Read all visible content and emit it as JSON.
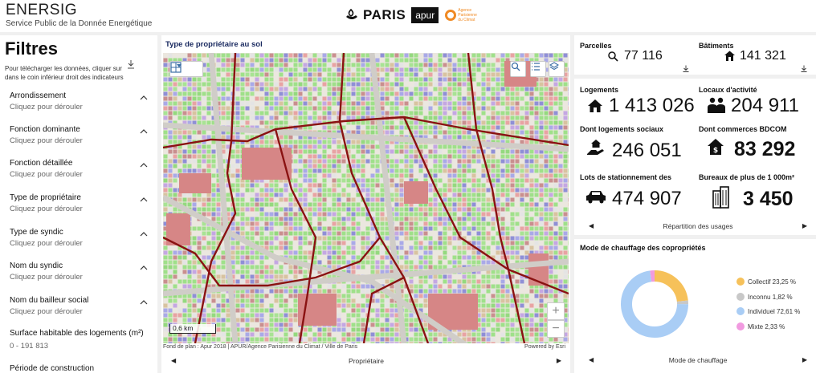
{
  "header": {
    "app_title": "ENERSIG",
    "app_subtitle": "Service Public de la Donnée Energétique",
    "logo_paris": "PARIS",
    "logo_apur": "apur",
    "logo_climat": "Agence Parisienne du Climat"
  },
  "sidebar": {
    "title": "Filtres",
    "note": "Pour télécharger les données, cliquer sur dans le coin inférieur droit des indicateurs",
    "filters": [
      {
        "label": "Arrondissement",
        "hint": "Cliquez pour dérouler"
      },
      {
        "label": "Fonction dominante",
        "hint": "Cliquez pour dérouler"
      },
      {
        "label": "Fonction détaillée",
        "hint": "Cliquez pour dérouler"
      },
      {
        "label": "Type de propriétaire",
        "hint": "Cliquez pour dérouler"
      },
      {
        "label": "Type de syndic",
        "hint": "Cliquez pour dérouler"
      },
      {
        "label": "Nom du syndic",
        "hint": "Cliquez pour dérouler"
      },
      {
        "label": "Nom du bailleur social",
        "hint": "Cliquez pour dérouler"
      }
    ],
    "surface_label": "Surface habitable des logements (m²)",
    "surface_value": "0 - 191 813",
    "periode_label": "Période de construction"
  },
  "map": {
    "title": "Type de propriétaire au sol",
    "scale_label": "0,6 km",
    "attribution_left": "Fond de plan : Apur 2018 | APUR/Agence Parisienne du Climat / Ville de Paris",
    "attribution_right": "Powered by Esri",
    "nav_label": "Propriétaire",
    "zoom_in": "+",
    "zoom_out": "−"
  },
  "stats_top": {
    "parcelles_label": "Parcelles",
    "parcelles_value": "77 116",
    "batiments_label": "Bâtiments",
    "batiments_value": "141 321"
  },
  "stats_main": {
    "logements_label": "Logements",
    "logements_value": "1 413 026",
    "locaux_label": "Locaux d'activité",
    "locaux_value": "204 911",
    "sociaux_label": "Dont logements sociaux",
    "sociaux_value": "246 051",
    "commerces_label": "Dont commerces BDCOM",
    "commerces_value": "83 292",
    "stationnement_label": "Lots de stationnement des",
    "stationnement_value": "474 907",
    "bureaux_label": "Bureaux de plus de 1 000m²",
    "bureaux_value": "3 450",
    "nav_label": "Répartition des usages"
  },
  "heating": {
    "title": "Mode de chauffage des copropriétés",
    "nav_label": "Mode de chauffage"
  },
  "chart_data": {
    "type": "pie",
    "title": "Mode de chauffage des copropriétés",
    "categories": [
      "Collectif",
      "Inconnu",
      "Individuel",
      "Mixte"
    ],
    "values": [
      23.25,
      1.82,
      72.61,
      2.33
    ],
    "labels": [
      "Collectif 23,25 %",
      "Inconnu 1,82 %",
      "Individuel 72,61 %",
      "Mixte 2,33 %"
    ],
    "colors": [
      "#f6c15a",
      "#c8c8c8",
      "#a9cdf5",
      "#f19ae0"
    ],
    "legend": "right",
    "donut": true
  }
}
